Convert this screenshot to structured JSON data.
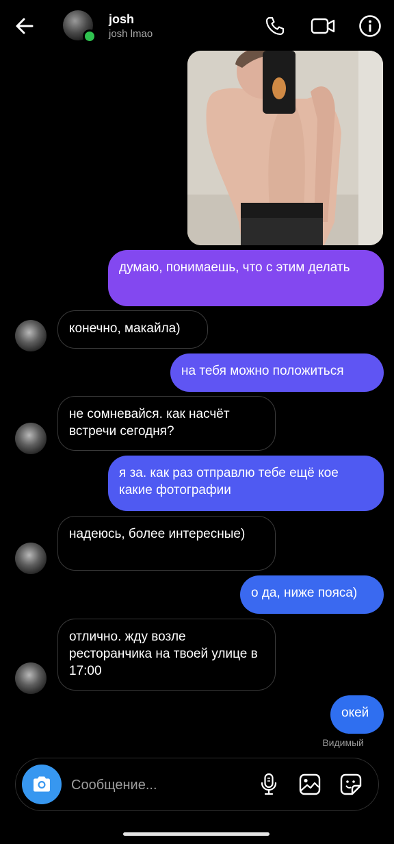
{
  "header": {
    "name": "josh",
    "username": "josh lmao",
    "icons": {
      "back": "arrow-left-icon",
      "call": "phone-icon",
      "video": "video-camera-icon",
      "info": "info-icon"
    },
    "online_color": "#2fc24f"
  },
  "messages": [
    {
      "type": "image",
      "side": "sent",
      "content": "mirror-selfie-photo"
    },
    {
      "side": "sent",
      "text": "думаю, понимаешь, что с этим делать",
      "color": "#8348f0"
    },
    {
      "side": "received",
      "text": "конечно, макайла)"
    },
    {
      "side": "sent",
      "text": "на тебя можно положиться",
      "color": "#5f55f3"
    },
    {
      "side": "received",
      "text": "не сомневайся. как насчёт встречи сегодня?"
    },
    {
      "side": "sent",
      "text": "я за. как раз отправлю тебе ещё кое какие фотографии",
      "color": "#4f5af2"
    },
    {
      "side": "received",
      "text": "надеюсь, более интересные)"
    },
    {
      "side": "sent",
      "text": "о да, ниже пояса)",
      "color": "#3a69f0"
    },
    {
      "side": "received",
      "text": "отлично. жду возле ресторанчика на твоей улице в 17:00"
    },
    {
      "side": "sent",
      "text": "окей",
      "color": "#2f6ff0"
    }
  ],
  "seen_status": "Видимый",
  "composer": {
    "placeholder": "Сообщение...",
    "icons": {
      "camera": "camera-icon",
      "mic": "microphone-icon",
      "gallery": "gallery-icon",
      "sticker": "sticker-icon"
    },
    "camera_color": "#3797f0"
  }
}
